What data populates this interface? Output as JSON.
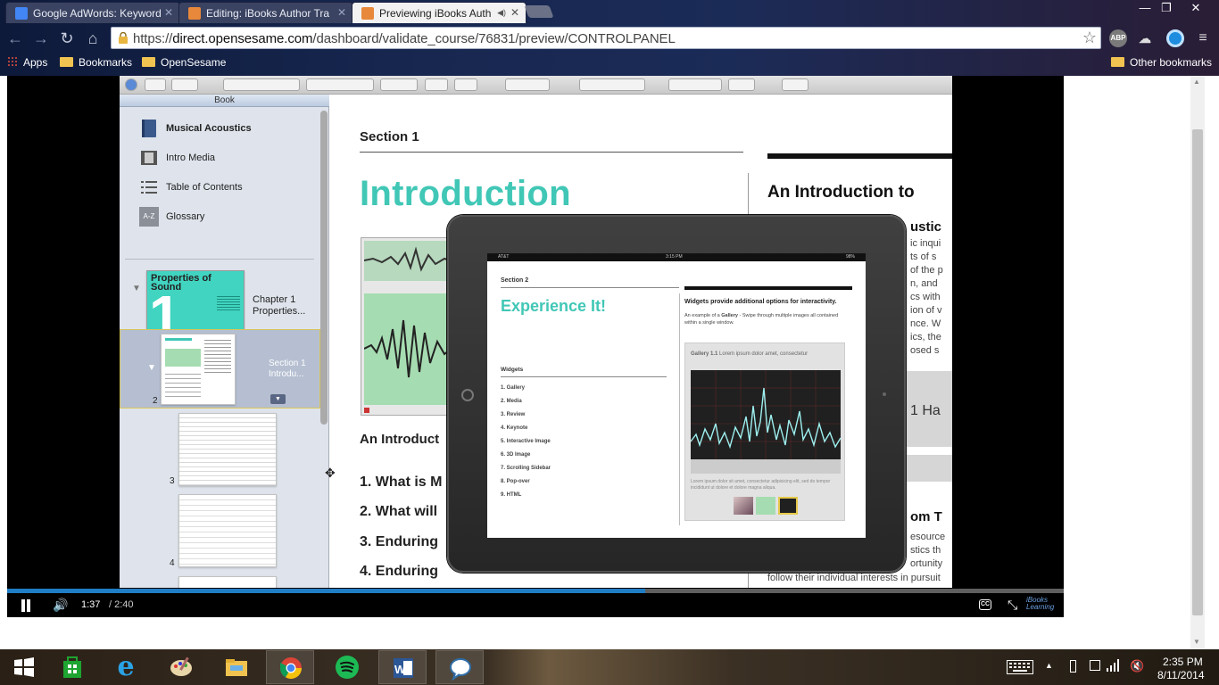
{
  "tabs": [
    {
      "title": "Google AdWords: Keyword",
      "favicon_color": "#4285f4",
      "active": false
    },
    {
      "title": "Editing: iBooks Author Tra",
      "favicon_color": "#e8883a",
      "active": false
    },
    {
      "title": "Previewing iBooks Auth",
      "favicon_color": "#e8883a",
      "active": true
    }
  ],
  "window_controls": {
    "minimize": "—",
    "restore": "❐",
    "close": "✕"
  },
  "address": {
    "scheme": "https://",
    "host": "direct.opensesame.com",
    "path": "/dashboard/validate_course/76831/preview/CONTROLPANEL"
  },
  "extensions": {
    "abp": "ABP"
  },
  "bookmarks_bar": {
    "apps": "Apps",
    "bookmarks": "Bookmarks",
    "opensesame": "OpenSesame",
    "other": "Other bookmarks"
  },
  "sidebar": {
    "header": "Book",
    "items": [
      {
        "label": "Musical Acoustics",
        "icon": "book-icon"
      },
      {
        "label": "Intro Media",
        "icon": "film-icon"
      },
      {
        "label": "Table of Contents",
        "icon": "list-icon"
      },
      {
        "label": "Glossary",
        "icon": "glossary-icon",
        "icon_text": "A-Z"
      }
    ],
    "chapter": {
      "thumb_title": "Properties of Sound",
      "big_num": "1",
      "label": "Chapter 1",
      "sub": "Properties...",
      "page": "1"
    },
    "section": {
      "label": "Section 1",
      "sub": "Introdu...",
      "page": "2"
    },
    "pages": [
      "3",
      "4"
    ]
  },
  "canvas": {
    "section_label": "Section 1",
    "title": "Introduction",
    "right_heading": "An Introduction to",
    "right_subhead": "ustic",
    "right_lines": [
      "ic inqui",
      "ts of s",
      "of the p",
      "n, and",
      "cs with",
      "ion of v",
      "nce. W",
      "ics, the",
      "osed s"
    ],
    "right_mid": "1 Ha",
    "right_sub2": "om T",
    "right_lines2": [
      "esource",
      "stics th",
      "ortunity",
      "follow their individual interests in pursuit"
    ],
    "subheading": "An Introduct",
    "objectives": [
      "1.  What is M",
      "2.  What will",
      "3.  Enduring",
      "4.  Enduring"
    ]
  },
  "ipad": {
    "status": {
      "carrier": "AT&T",
      "time": "3:15 PM",
      "battery": "98%"
    },
    "section": "Section 2",
    "title": "Experience It!",
    "right_heading": "Widgets provide additional options for interactivity.",
    "right_text_prefix": "An example of a ",
    "right_text_bold": "Gallery",
    "right_text_suffix": " - Swipe through multiple images all contained within a single window.",
    "widgets_heading": "Widgets",
    "widgets": [
      "1.  Gallery",
      "2.  Media",
      "3.  Review",
      "4.  Keynote",
      "5.  Interactive Image",
      "6.  3D Image",
      "7.  Scrolling Sidebar",
      "8.  Pop-over",
      "9.  HTML"
    ],
    "gallery_caption_bold": "Gallery 1.1",
    "gallery_caption": " Lorem ipsum dolor amet, consectetur",
    "gallery_text": "Lorem ipsum dolor sit amet, consectetur adipisicing elit, sed do tempor incididunt ut dolore et dolore magna aliqua."
  },
  "video": {
    "current_time": "1:37",
    "total_time": "/ 2:40",
    "progress": 0.604,
    "cc": "CC",
    "brand": "iBooks Learning"
  },
  "taskbar": {
    "time": "2:35 PM",
    "date": "8/11/2014"
  }
}
